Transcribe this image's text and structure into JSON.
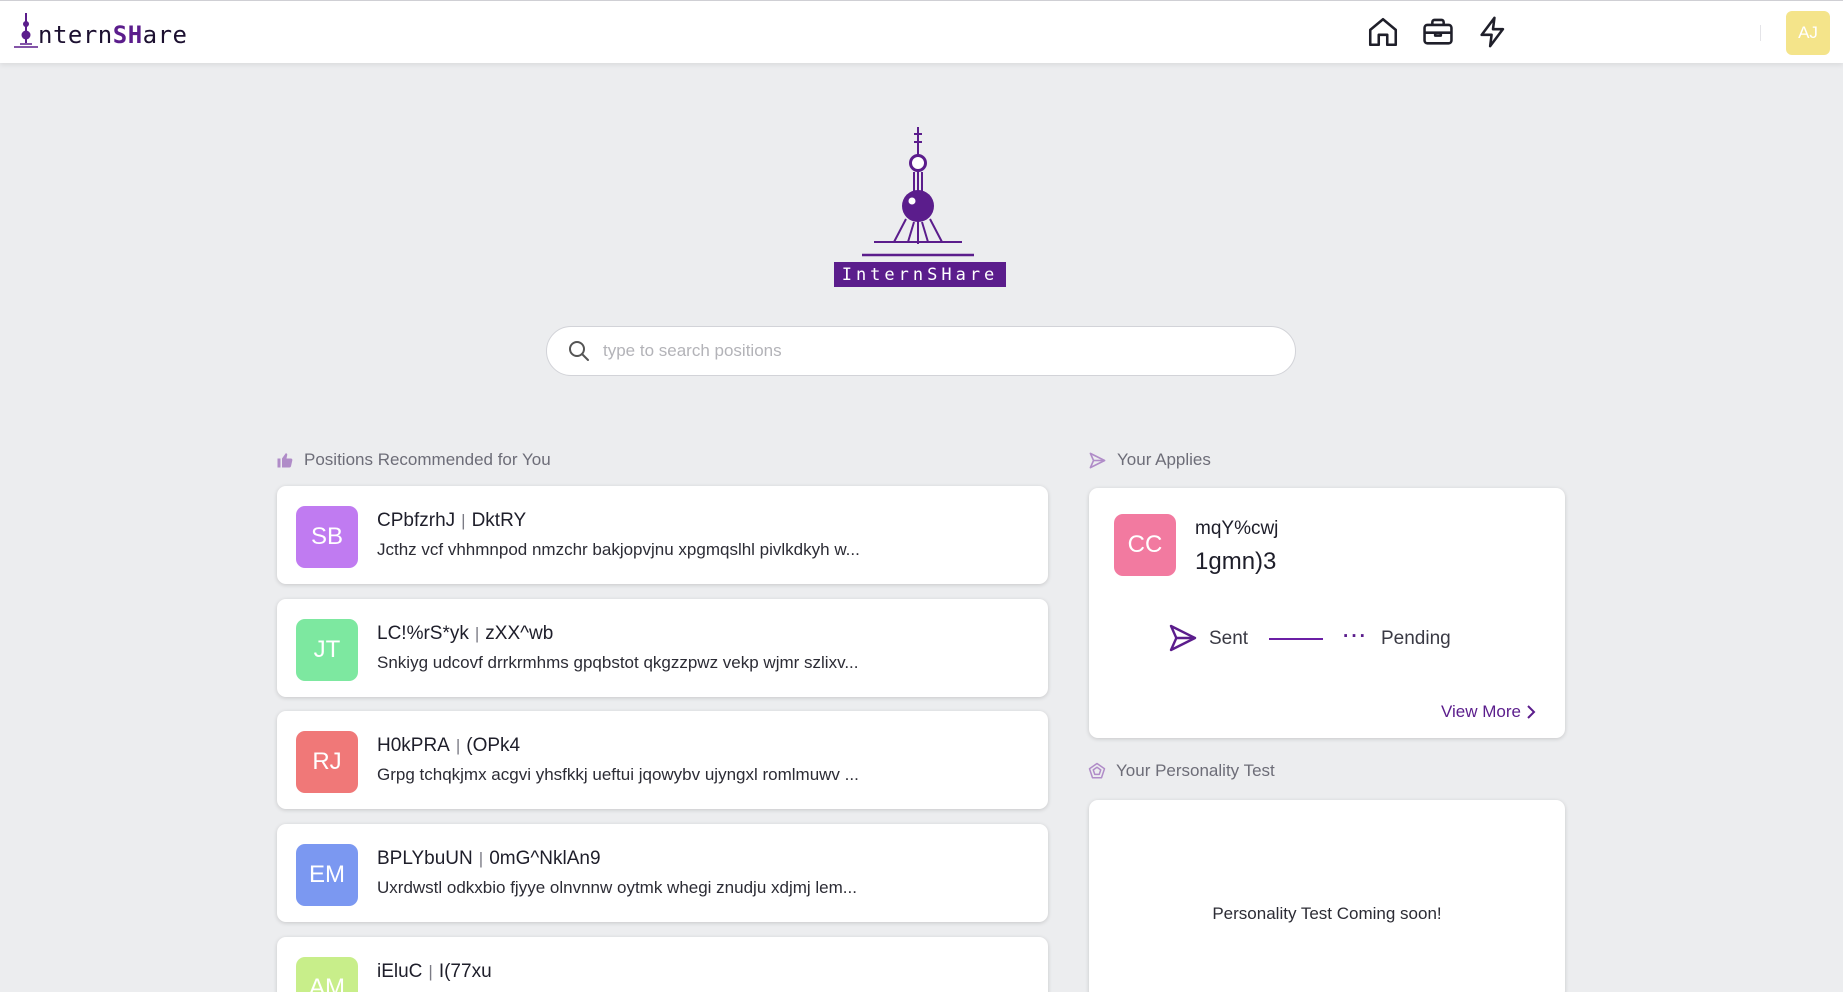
{
  "header": {
    "brand_prefix": "ntern",
    "brand_accent": "SH",
    "brand_suffix": "are",
    "user_initials": "AJ",
    "nav": [
      "home-icon",
      "briefcase-icon",
      "lightning-icon"
    ]
  },
  "hero": {
    "logo_text": "InternSHare"
  },
  "search": {
    "placeholder": "type to search positions",
    "value": ""
  },
  "recommended": {
    "title": "Positions Recommended for You",
    "items": [
      {
        "initials": "SB",
        "color": "#c07bf1",
        "company": "CPbfzrhJ",
        "position": "DktRY",
        "desc": "Jcthz vcf vhhmnpod nmzchr bakjopvjnu xpgmqslhl pivlkdkyh w..."
      },
      {
        "initials": "JT",
        "color": "#7de8a0",
        "company": "LC!%rS*yk",
        "position": "zXX^wb",
        "desc": "Snkiyg udcovf drrkrmhms gpqbstot qkgzzpwz vekp wjmr szlixv..."
      },
      {
        "initials": "RJ",
        "color": "#f07878",
        "company": "H0kPRA",
        "position": "(OPk4",
        "desc": "Grpg tchqkjmx acgvi yhsfkkj ueftui jqowybv ujyngxl romlmuwv ..."
      },
      {
        "initials": "EM",
        "color": "#7b98f1",
        "company": "BPLYbuUN",
        "position": "0mG^NklAn9",
        "desc": "Uxrdwstl odkxbio fjyye olnvnnw oytmk whegi znudju xdjmj lem..."
      },
      {
        "initials": "AM",
        "color": "#c8ee8a",
        "company": "iEluC",
        "position": "I(77xu",
        "desc": ""
      }
    ]
  },
  "applies": {
    "title": "Your Applies",
    "card": {
      "initials": "CC",
      "company": "mqY%cwj",
      "position": "1gmn)3",
      "status_sent": "Sent",
      "status_pending": "Pending",
      "view_more": "View More"
    }
  },
  "personality": {
    "title": "Your Personality Test",
    "message": "Personality Test Coming soon!"
  },
  "colors": {
    "brand": "#5b1d8c",
    "background": "#ecedef"
  }
}
